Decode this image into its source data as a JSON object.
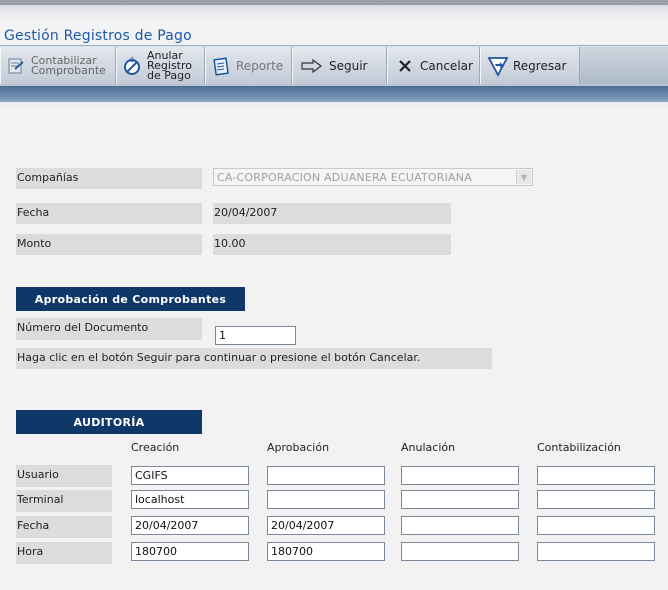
{
  "app": {
    "title": "Gestión Registros de Pago"
  },
  "toolbar": {
    "contabilizar": "Contabilizar Comprobante",
    "contabilizar_l1": "Contabilizar",
    "contabilizar_l2": "Comprobante",
    "anular_l1": "Anular",
    "anular_l2": "Registro",
    "anular_l3": "de Pago",
    "reporte": "Reporte",
    "seguir": "Seguir",
    "cancelar": "Cancelar",
    "regresar": "Regresar"
  },
  "form": {
    "companias_label": "Compañías",
    "companias_value": "CA-CORPORACION ADUANERA ECUATORIANA",
    "fecha_label": "Fecha",
    "fecha_value": "20/04/2007",
    "monto_label": "Monto",
    "monto_value": "10.00"
  },
  "aprobacion": {
    "header": "Aprobación de Comprobantes",
    "numero_label": "Número del Documento",
    "numero_value": "1",
    "instructions": "Haga clic en el botón Seguir para continuar o presione el botón Cancelar."
  },
  "auditoria": {
    "header": "AUDITORÍA",
    "columns": [
      "Creación",
      "Aprobación",
      "Anulación",
      "Contabilización"
    ],
    "rows": [
      {
        "label": "Usuario",
        "values": [
          "CGIFS",
          "",
          "",
          ""
        ]
      },
      {
        "label": "Terminal",
        "values": [
          "localhost",
          "",
          "",
          ""
        ]
      },
      {
        "label": "Fecha",
        "values": [
          "20/04/2007",
          "20/04/2007",
          "",
          ""
        ]
      },
      {
        "label": "Hora",
        "values": [
          "180700",
          "180700",
          "",
          ""
        ]
      }
    ]
  },
  "colors": {
    "title": "#1a5aa8",
    "section_header": "#0f3768",
    "label_bg": "#dcdcdc"
  },
  "icons": [
    "contabilizar-icon",
    "anular-icon",
    "reporte-icon",
    "arrow-right-icon",
    "x-icon",
    "regresar-icon"
  ]
}
